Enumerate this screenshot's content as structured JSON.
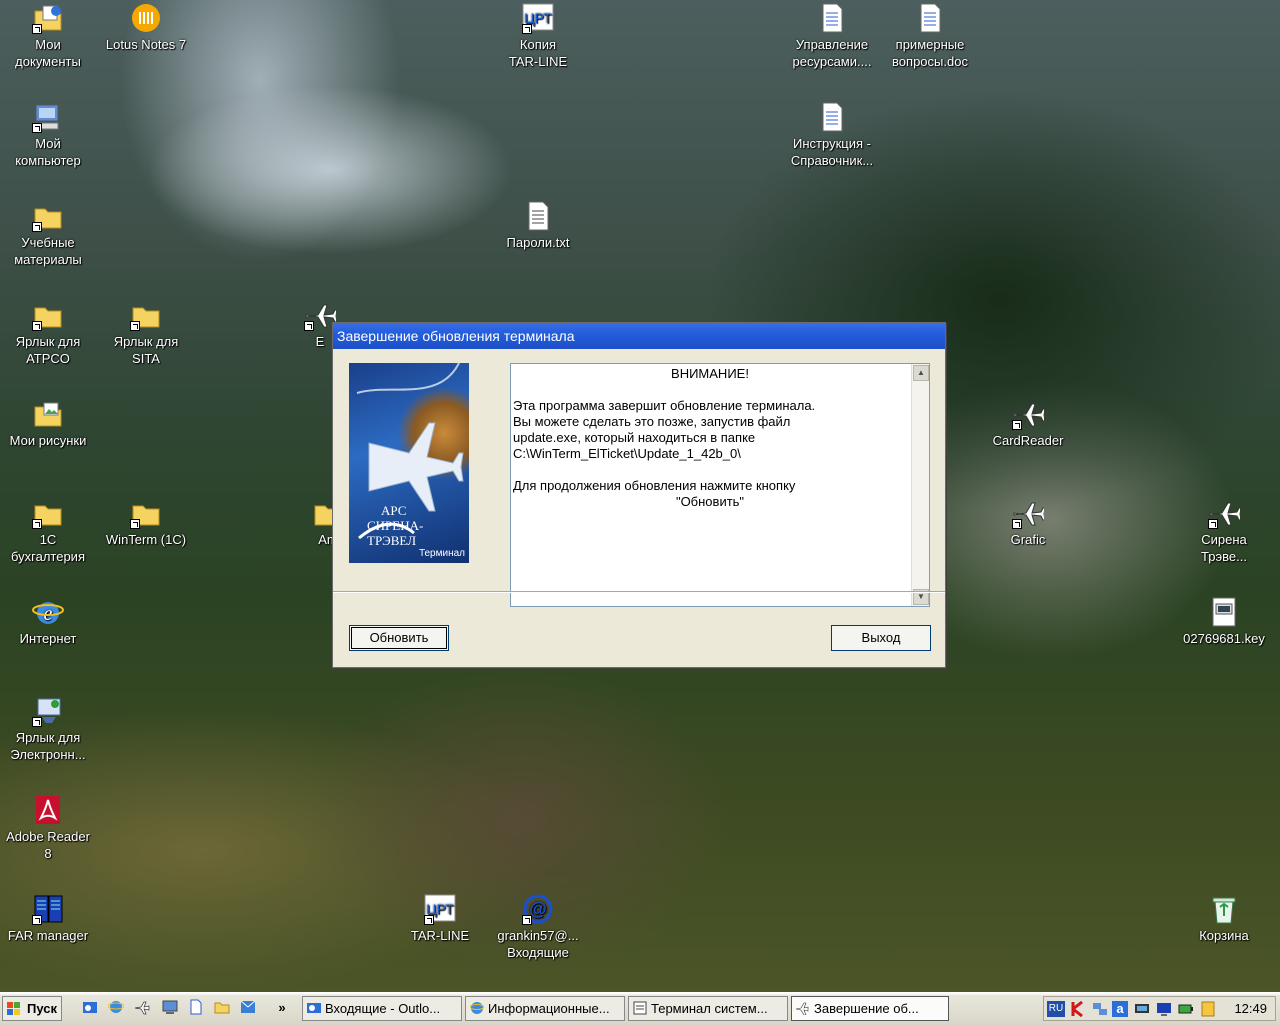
{
  "desktop": {
    "icons": [
      {
        "id": "my-documents",
        "label": "Мои\nдокументы",
        "icon": "folder-documents-icon"
      },
      {
        "id": "lotus-notes",
        "label": "Lotus Notes 7",
        "icon": "lotus-notes-icon"
      },
      {
        "id": "kopiya-tar-line",
        "label": "Копия\nTAR-LINE",
        "icon": "cpt-app-icon"
      },
      {
        "id": "upravlenie",
        "label": "Управление\nресурсами....",
        "icon": "word-document-icon"
      },
      {
        "id": "primernye",
        "label": "примерные\nвопросы.doc",
        "icon": "word-document-icon"
      },
      {
        "id": "my-computer",
        "label": "Мой\nкомпьютер",
        "icon": "computer-icon"
      },
      {
        "id": "instrukciya",
        "label": "Инструкция -\nСправочник...",
        "icon": "word-document-icon"
      },
      {
        "id": "uchebnye",
        "label": "Учебные\nматериалы",
        "icon": "folder-icon"
      },
      {
        "id": "paroli",
        "label": "Пароли.txt",
        "icon": "text-file-icon"
      },
      {
        "id": "yarlyk-atpco",
        "label": "Ярлык для\nATPCO",
        "icon": "folder-icon"
      },
      {
        "id": "yarlyk-sita",
        "label": "Ярлык для\nSITA",
        "icon": "folder-icon"
      },
      {
        "id": "my-pictures",
        "label": "Мои рисунки",
        "icon": "folder-pictures-icon"
      },
      {
        "id": "cardreader",
        "label": "CardReader",
        "icon": "airplane-icon"
      },
      {
        "id": "1c-buh",
        "label": "1С\nбухгалтерия",
        "icon": "folder-icon"
      },
      {
        "id": "winterm",
        "label": "WinTerm (1С)",
        "icon": "folder-icon"
      },
      {
        "id": "grafic",
        "label": "Grafic",
        "icon": "airplane-icon"
      },
      {
        "id": "sirena-treve",
        "label": "Сирена\nТрэве...",
        "icon": "airplane-icon"
      },
      {
        "id": "internet",
        "label": "Интернет",
        "icon": "internet-explorer-icon"
      },
      {
        "id": "key-file",
        "label": "02769681.key",
        "icon": "key-file-icon"
      },
      {
        "id": "yarlyk-electron",
        "label": "Ярлык для\nЭлектронн...",
        "icon": "network-shortcut-icon"
      },
      {
        "id": "adobe-reader",
        "label": "Adobe Reader\n8",
        "icon": "adobe-reader-icon"
      },
      {
        "id": "far-manager",
        "label": "FAR manager",
        "icon": "far-manager-icon"
      },
      {
        "id": "tar-line",
        "label": "TAR-LINE",
        "icon": "cpt-app-icon"
      },
      {
        "id": "grankin",
        "label": "grankin57@...\nВходящие",
        "icon": "mail-icon"
      },
      {
        "id": "recycle-bin",
        "label": "Корзина",
        "icon": "recycle-bin-icon"
      },
      {
        "id": "partial-e",
        "label": "E",
        "icon": "airplane-icon"
      },
      {
        "id": "partial-am",
        "label": "Am",
        "icon": "folder-icon"
      }
    ]
  },
  "dialog": {
    "title": "Завершение обновления терминала",
    "logo": {
      "brand_line1": "АРС",
      "brand_line2": "СИРЕНА-ТРЭВЕЛ",
      "sub": "Терминал"
    },
    "message": {
      "heading": "ВНИМАНИЕ!",
      "line1": "Эта программа завершит обновление терминала.",
      "line2": "Вы можете сделать это позже, запустив файл",
      "line3": "update.exe, который находиться в папке",
      "line4": "C:\\WinTerm_ElTicket\\Update_1_42b_0\\",
      "line5": "Для продолжения обновления нажмите кнопку",
      "line6": "\"Обновить\""
    },
    "buttons": {
      "update": "Обновить",
      "exit": "Выход"
    }
  },
  "taskbar": {
    "start_label": "Пуск",
    "overflow": "»",
    "tasks": [
      {
        "label": "Входящие - Outlo...",
        "icon": "outlook-icon",
        "active": false
      },
      {
        "label": "Информационные...",
        "icon": "internet-explorer-icon",
        "active": false
      },
      {
        "label": "Терминал систем...",
        "icon": "terminal-icon",
        "active": false
      },
      {
        "label": "Завершение об...",
        "icon": "airplane-icon",
        "active": true
      }
    ],
    "tray": {
      "language": "RU",
      "clock": "12:49"
    }
  },
  "colors": {
    "title_bar": "#245edb",
    "dialog_bg": "#ece9d8",
    "taskbar_bg": "#d9d6c8"
  }
}
